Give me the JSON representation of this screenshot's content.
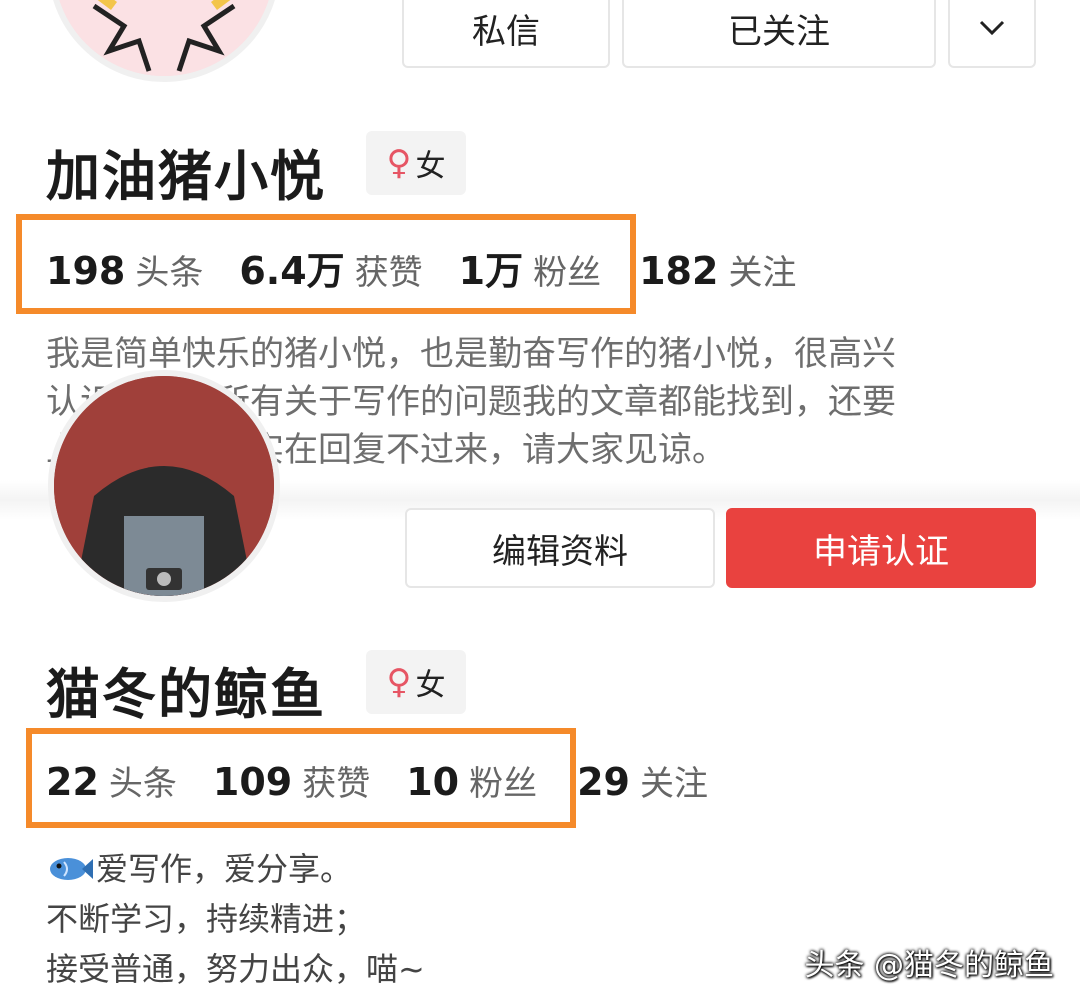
{
  "top_profile": {
    "buttons": {
      "message": "私信",
      "follow_state": "已关注",
      "more_icon": "chevron-down-icon"
    },
    "name": "加油猪小悦",
    "gender_symbol": "♀",
    "gender": "女",
    "stats": [
      {
        "value": "198",
        "label": "头条"
      },
      {
        "value": "6.4万",
        "label": "获赞"
      },
      {
        "value": "1万",
        "label": "粉丝"
      },
      {
        "value": "182",
        "label": "关注"
      }
    ],
    "bio": [
      "我是简单快乐的猪小悦，也是勤奋写作的猪小悦，很高兴",
      "认识大家。所有关于写作的问题我的文章都能找到，还要",
      "上班，私信我实在回复不过来，请大家见谅。"
    ]
  },
  "bottom_profile": {
    "buttons": {
      "edit": "编辑资料",
      "verify": "申请认证"
    },
    "name": "猫冬的鲸鱼",
    "gender_symbol": "♀",
    "gender": "女",
    "stats": [
      {
        "value": "22",
        "label": "头条"
      },
      {
        "value": "109",
        "label": "获赞"
      },
      {
        "value": "10",
        "label": "粉丝"
      },
      {
        "value": "29",
        "label": "关注"
      }
    ],
    "bio_icon": "fish-icon",
    "bio": [
      "爱写作，爱分享。",
      "不断学习，持续精进；",
      "接受普通，努力出众，喵~"
    ]
  },
  "watermark": "头条 @猫冬的鲸鱼",
  "colors": {
    "highlight": "#f58a2a",
    "accent_red": "#e9423f",
    "gender_pink": "#e65564"
  }
}
